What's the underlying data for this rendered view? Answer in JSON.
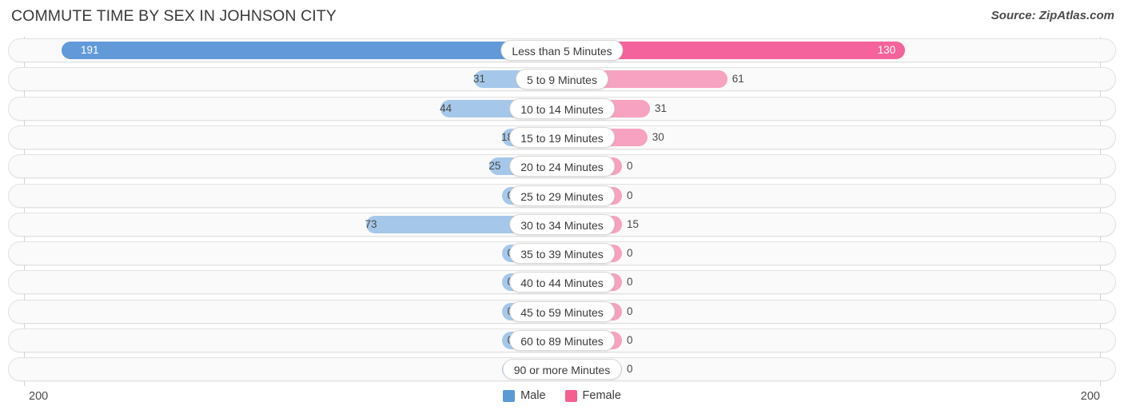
{
  "header": {
    "title": "COMMUTE TIME BY SEX IN JOHNSON CITY",
    "source": "Source: ZipAtlas.com"
  },
  "axis": {
    "left_tick": "200",
    "right_tick": "200"
  },
  "legend": {
    "items": [
      {
        "label": "Male",
        "color": "#5b9bd5"
      },
      {
        "label": "Female",
        "color": "#f4608f"
      }
    ]
  },
  "colors": {
    "male_strong": "#629ad9",
    "male_light": "#a5c8ea",
    "female_strong": "#f4639b",
    "female_light": "#f7a2c0",
    "track_fill": "#fafafa",
    "track_border": "#e2e2e2"
  },
  "chart_data": {
    "type": "bar",
    "title": "COMMUTE TIME BY SEX IN JOHNSON CITY",
    "subtitle": "",
    "xlabel": "",
    "ylabel": "",
    "orientation": "horizontal-diverging",
    "legend_position": "bottom-center",
    "grid": false,
    "axis_max": 200,
    "xlim": [
      200,
      200
    ],
    "categories": [
      "Less than 5 Minutes",
      "5 to 9 Minutes",
      "10 to 14 Minutes",
      "15 to 19 Minutes",
      "20 to 24 Minutes",
      "25 to 29 Minutes",
      "30 to 34 Minutes",
      "35 to 39 Minutes",
      "40 to 44 Minutes",
      "45 to 59 Minutes",
      "60 to 89 Minutes",
      "90 or more Minutes"
    ],
    "series": [
      {
        "name": "Male",
        "color": "#5b9bd5",
        "values": [
          191,
          31,
          44,
          18,
          25,
          0,
          73,
          0,
          0,
          0,
          0,
          0
        ]
      },
      {
        "name": "Female",
        "color": "#f4608f",
        "values": [
          130,
          61,
          31,
          30,
          0,
          0,
          15,
          0,
          0,
          0,
          0,
          0
        ]
      }
    ]
  }
}
